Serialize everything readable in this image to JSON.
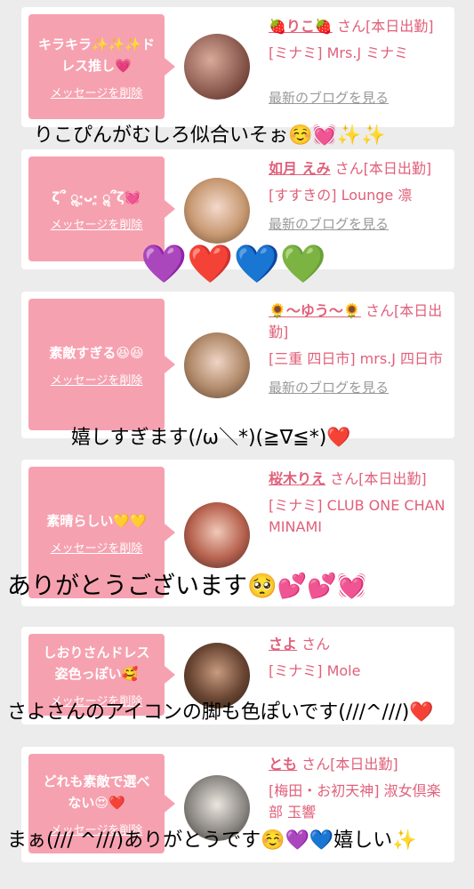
{
  "delete_label": "メッセージを削除",
  "blog_label": "最新のブログを見る",
  "cards": [
    {
      "message": "キラキラ✨✨✨ドレス推し💗",
      "name": "🍓りこ🍓",
      "san": "さん[本日出勤]",
      "shop": "[ミナミ] Mrs.J ミナミ",
      "reply": "りこぴんがむしろ似合いそぉ☺️💓✨✨"
    },
    {
      "message": "ζ՞ ॢ·͈ᴗ·͈ ॢ՞ζ💓",
      "name": "如月 えみ",
      "san": "さん[本日出勤]",
      "shop": "[すすきの] Lounge 凛",
      "reply": "💜❤️💙💚"
    },
    {
      "message": "素敵すぎる😆😆",
      "name": "🌻〜ゆう〜🌻",
      "san": "さん[本日出勤]",
      "shop": "[三重 四日市] mrs.J 四日市",
      "reply": "嬉しすぎます(/ω＼*)(≧∇≦*)❤️"
    },
    {
      "message": "素晴らしい💛💛",
      "name": "桜木りえ",
      "san": "さん[本日出勤]",
      "shop": "[ミナミ] CLUB ONE CHAN MINAMI",
      "reply": "ありがとうございます🥺💕💕💓"
    },
    {
      "message": "しおりさんドレス姿色っぽい🥰",
      "name": "さよ",
      "san": "さん",
      "shop": "[ミナミ] Mole",
      "reply": "さよさんのアイコンの脚も色ぽいです(///^///)❤️"
    },
    {
      "message": "どれも素敵で選べない😍❤️",
      "name": "とも",
      "san": "さん[本日出勤]",
      "shop": "[梅田・お初天神] 淑女倶楽部 玉響",
      "reply": "まぁ(/// ^///)ありがとうです☺️💜💙嬉しい✨"
    }
  ]
}
